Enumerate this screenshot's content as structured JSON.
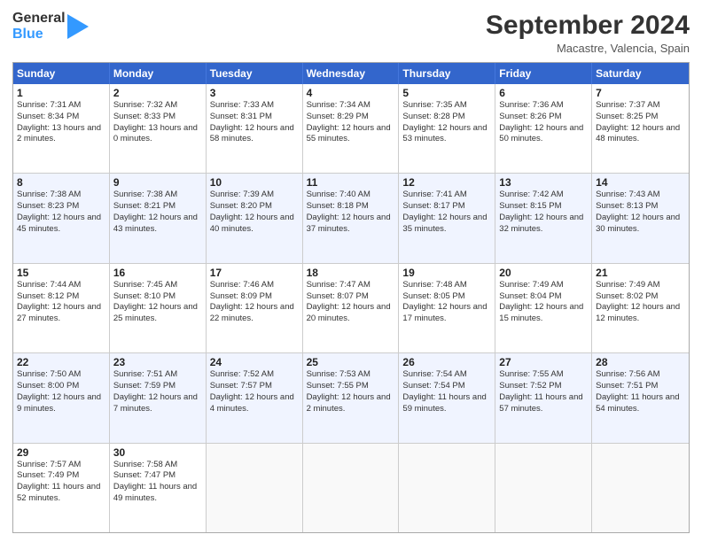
{
  "logo": {
    "line1": "General",
    "line2": "Blue"
  },
  "title": "September 2024",
  "location": "Macastre, Valencia, Spain",
  "days": [
    "Sunday",
    "Monday",
    "Tuesday",
    "Wednesday",
    "Thursday",
    "Friday",
    "Saturday"
  ],
  "rows": [
    [
      {
        "day": "1",
        "sunrise": "7:31 AM",
        "sunset": "8:34 PM",
        "daylight": "13 hours and 2 minutes."
      },
      {
        "day": "2",
        "sunrise": "7:32 AM",
        "sunset": "8:33 PM",
        "daylight": "13 hours and 0 minutes."
      },
      {
        "day": "3",
        "sunrise": "7:33 AM",
        "sunset": "8:31 PM",
        "daylight": "12 hours and 58 minutes."
      },
      {
        "day": "4",
        "sunrise": "7:34 AM",
        "sunset": "8:29 PM",
        "daylight": "12 hours and 55 minutes."
      },
      {
        "day": "5",
        "sunrise": "7:35 AM",
        "sunset": "8:28 PM",
        "daylight": "12 hours and 53 minutes."
      },
      {
        "day": "6",
        "sunrise": "7:36 AM",
        "sunset": "8:26 PM",
        "daylight": "12 hours and 50 minutes."
      },
      {
        "day": "7",
        "sunrise": "7:37 AM",
        "sunset": "8:25 PM",
        "daylight": "12 hours and 48 minutes."
      }
    ],
    [
      {
        "day": "8",
        "sunrise": "7:38 AM",
        "sunset": "8:23 PM",
        "daylight": "12 hours and 45 minutes."
      },
      {
        "day": "9",
        "sunrise": "7:38 AM",
        "sunset": "8:21 PM",
        "daylight": "12 hours and 43 minutes."
      },
      {
        "day": "10",
        "sunrise": "7:39 AM",
        "sunset": "8:20 PM",
        "daylight": "12 hours and 40 minutes."
      },
      {
        "day": "11",
        "sunrise": "7:40 AM",
        "sunset": "8:18 PM",
        "daylight": "12 hours and 37 minutes."
      },
      {
        "day": "12",
        "sunrise": "7:41 AM",
        "sunset": "8:17 PM",
        "daylight": "12 hours and 35 minutes."
      },
      {
        "day": "13",
        "sunrise": "7:42 AM",
        "sunset": "8:15 PM",
        "daylight": "12 hours and 32 minutes."
      },
      {
        "day": "14",
        "sunrise": "7:43 AM",
        "sunset": "8:13 PM",
        "daylight": "12 hours and 30 minutes."
      }
    ],
    [
      {
        "day": "15",
        "sunrise": "7:44 AM",
        "sunset": "8:12 PM",
        "daylight": "12 hours and 27 minutes."
      },
      {
        "day": "16",
        "sunrise": "7:45 AM",
        "sunset": "8:10 PM",
        "daylight": "12 hours and 25 minutes."
      },
      {
        "day": "17",
        "sunrise": "7:46 AM",
        "sunset": "8:09 PM",
        "daylight": "12 hours and 22 minutes."
      },
      {
        "day": "18",
        "sunrise": "7:47 AM",
        "sunset": "8:07 PM",
        "daylight": "12 hours and 20 minutes."
      },
      {
        "day": "19",
        "sunrise": "7:48 AM",
        "sunset": "8:05 PM",
        "daylight": "12 hours and 17 minutes."
      },
      {
        "day": "20",
        "sunrise": "7:49 AM",
        "sunset": "8:04 PM",
        "daylight": "12 hours and 15 minutes."
      },
      {
        "day": "21",
        "sunrise": "7:49 AM",
        "sunset": "8:02 PM",
        "daylight": "12 hours and 12 minutes."
      }
    ],
    [
      {
        "day": "22",
        "sunrise": "7:50 AM",
        "sunset": "8:00 PM",
        "daylight": "12 hours and 9 minutes."
      },
      {
        "day": "23",
        "sunrise": "7:51 AM",
        "sunset": "7:59 PM",
        "daylight": "12 hours and 7 minutes."
      },
      {
        "day": "24",
        "sunrise": "7:52 AM",
        "sunset": "7:57 PM",
        "daylight": "12 hours and 4 minutes."
      },
      {
        "day": "25",
        "sunrise": "7:53 AM",
        "sunset": "7:55 PM",
        "daylight": "12 hours and 2 minutes."
      },
      {
        "day": "26",
        "sunrise": "7:54 AM",
        "sunset": "7:54 PM",
        "daylight": "11 hours and 59 minutes."
      },
      {
        "day": "27",
        "sunrise": "7:55 AM",
        "sunset": "7:52 PM",
        "daylight": "11 hours and 57 minutes."
      },
      {
        "day": "28",
        "sunrise": "7:56 AM",
        "sunset": "7:51 PM",
        "daylight": "11 hours and 54 minutes."
      }
    ],
    [
      {
        "day": "29",
        "sunrise": "7:57 AM",
        "sunset": "7:49 PM",
        "daylight": "11 hours and 52 minutes."
      },
      {
        "day": "30",
        "sunrise": "7:58 AM",
        "sunset": "7:47 PM",
        "daylight": "11 hours and 49 minutes."
      },
      {
        "day": "",
        "sunrise": "",
        "sunset": "",
        "daylight": ""
      },
      {
        "day": "",
        "sunrise": "",
        "sunset": "",
        "daylight": ""
      },
      {
        "day": "",
        "sunrise": "",
        "sunset": "",
        "daylight": ""
      },
      {
        "day": "",
        "sunrise": "",
        "sunset": "",
        "daylight": ""
      },
      {
        "day": "",
        "sunrise": "",
        "sunset": "",
        "daylight": ""
      }
    ]
  ],
  "labels": {
    "sunrise": "Sunrise:",
    "sunset": "Sunset:",
    "daylight": "Daylight:"
  }
}
